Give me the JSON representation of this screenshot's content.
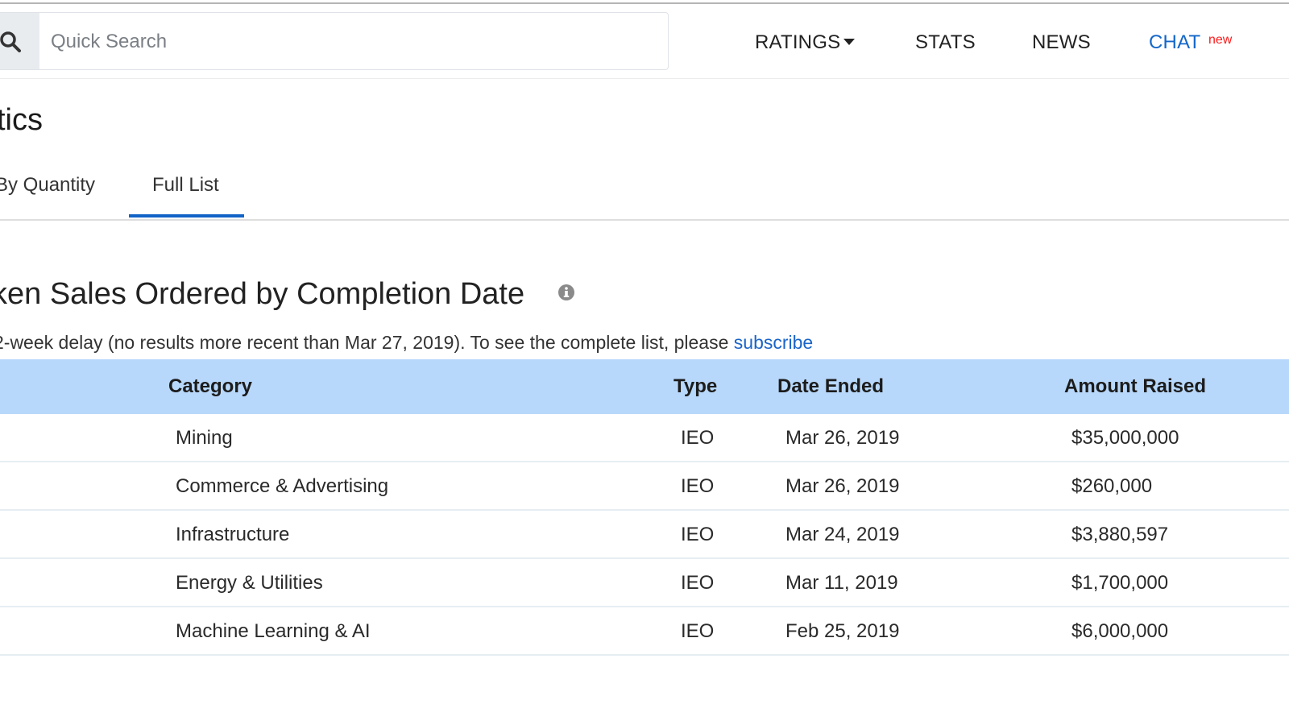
{
  "header": {
    "search": {
      "placeholder": "Quick Search",
      "value": ""
    },
    "nav": [
      {
        "label": "RATINGS",
        "has_dropdown": true
      },
      {
        "label": "STATS"
      },
      {
        "label": "NEWS"
      },
      {
        "label": "CHAT",
        "badge": "new",
        "color": "#1467c8"
      }
    ]
  },
  "page": {
    "title_visible": "tics",
    "tabs": [
      {
        "label": "By Quantity",
        "visible_label": "By Quantity",
        "active": false
      },
      {
        "label": "Full List",
        "active": true
      }
    ]
  },
  "section": {
    "title_visible": "ken Sales Ordered by Completion Date",
    "notice_text": "2-week delay (no results more recent than Mar 27, 2019). To see the complete list, please ",
    "notice_link": "subscribe"
  },
  "table": {
    "columns": [
      "Category",
      "Type",
      "Date Ended",
      "Amount Raised"
    ],
    "rows": [
      {
        "category": "Mining",
        "type": "IEO",
        "date_ended": "Mar 26, 2019",
        "amount_raised": "$35,000,000",
        "name_fragment": ""
      },
      {
        "category": "Commerce & Advertising",
        "type": "IEO",
        "date_ended": "Mar 26, 2019",
        "amount_raised": "$260,000",
        "name_fragment": ""
      },
      {
        "category": "Infrastructure",
        "type": "IEO",
        "date_ended": "Mar 24, 2019",
        "amount_raised": "$3,880,597",
        "name_fragment": ":"
      },
      {
        "category": "Energy & Utilities",
        "type": "IEO",
        "date_ended": "Mar 11, 2019",
        "amount_raised": "$1,700,000",
        "name_fragment": ""
      },
      {
        "category": "Machine Learning & AI",
        "type": "IEO",
        "date_ended": "Feb 25, 2019",
        "amount_raised": "$6,000,000",
        "name_fragment": ""
      }
    ]
  },
  "colors": {
    "accent": "#1263c6",
    "table_header_bg": "#b8d8fb",
    "new_badge": "#ff1a1a"
  }
}
